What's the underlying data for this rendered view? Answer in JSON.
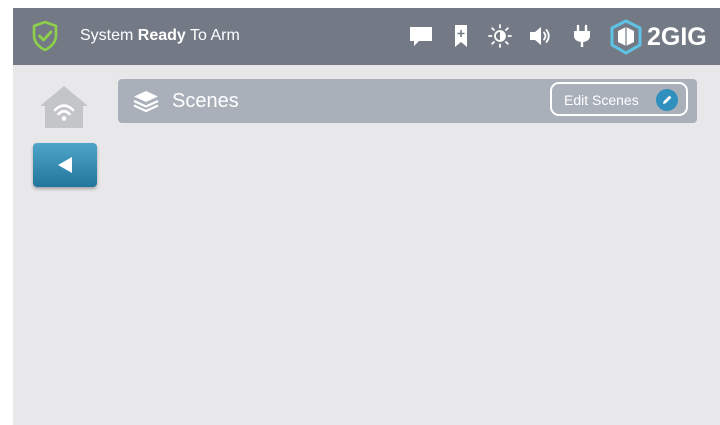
{
  "status": {
    "prefix": "System ",
    "state": "Ready",
    "suffix": " To Arm",
    "shield_icon": "shield-check-icon",
    "icons": [
      "message-icon",
      "bookmark-icon",
      "brightness-icon",
      "volume-icon",
      "power-plug-icon"
    ]
  },
  "brand": {
    "name": "2GIG",
    "logo_icon": "2gig-cube-icon"
  },
  "nav": {
    "home_icon": "home-wifi-icon",
    "back_icon": "back-arrow-icon"
  },
  "scenes": {
    "title": "Scenes",
    "icon": "layers-icon",
    "edit_label": "Edit Scenes",
    "edit_icon": "pencil-icon"
  },
  "colors": {
    "status_bar": "#737a85",
    "background": "#e8e8ea",
    "scenes_bar": "#a9b0ba",
    "accent_blue": "#2f8fbd",
    "shield_green": "#8ed04a"
  }
}
